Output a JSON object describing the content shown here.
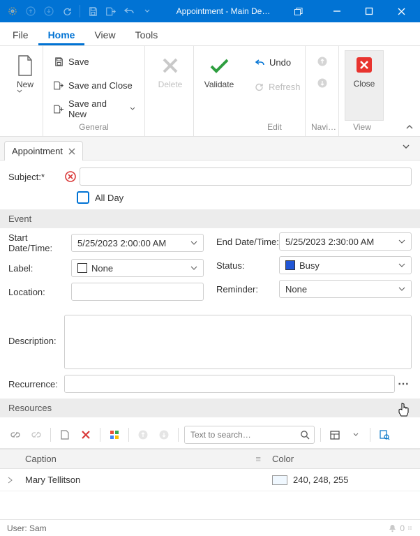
{
  "window": {
    "title": "Appointment - Main De…"
  },
  "menu": {
    "file": "File",
    "home": "Home",
    "view": "View",
    "tools": "Tools"
  },
  "ribbon": {
    "new": "New",
    "save": "Save",
    "save_close": "Save and Close",
    "save_new": "Save and New",
    "general": "General",
    "delete": "Delete",
    "validate": "Validate",
    "undo": "Undo",
    "refresh": "Refresh",
    "edit": "Edit",
    "navi": "Navi…",
    "close": "Close",
    "viewg": "View"
  },
  "tab": {
    "name": "Appointment"
  },
  "form": {
    "subject_label": "Subject:*",
    "allday_label": "All Day",
    "event_section": "Event",
    "start_label": "Start Date/Time:",
    "start_value": "5/25/2023 2:00:00 AM",
    "end_label": "End Date/Time:",
    "end_value": "5/25/2023 2:30:00 AM",
    "label_label": "Label:",
    "label_value": "None",
    "status_label": "Status:",
    "status_value": "Busy",
    "status_color": "#2156d6",
    "location_label": "Location:",
    "reminder_label": "Reminder:",
    "reminder_value": "None",
    "description_label": "Description:",
    "recurrence_label": "Recurrence:"
  },
  "resources": {
    "section": "Resources",
    "search_placeholder": "Text to search…",
    "col_caption": "Caption",
    "col_color": "Color",
    "row_caption": "Mary Tellitson",
    "row_color_text": "240, 248, 255"
  },
  "status": {
    "user": "User: Sam",
    "count": "0"
  }
}
